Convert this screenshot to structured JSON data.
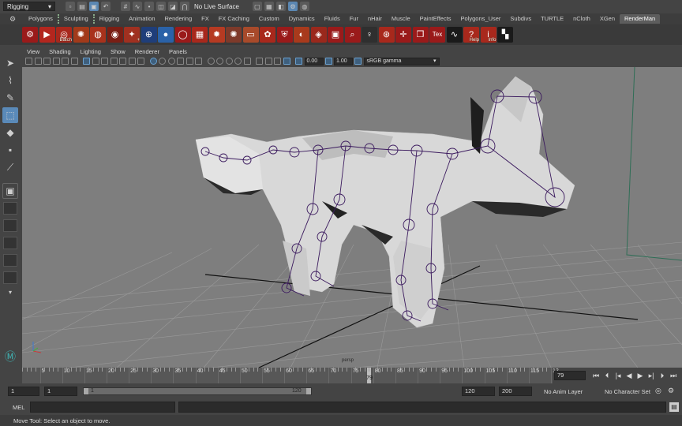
{
  "status_line": {
    "menu_set": "Rigging",
    "live_surface": "No Live Surface"
  },
  "shelf_tabs": [
    {
      "label": "Polygons",
      "sep": false,
      "active": false
    },
    {
      "label": "Sculpting",
      "sep": true,
      "active": false
    },
    {
      "label": "Rigging",
      "sep": true,
      "active": false
    },
    {
      "label": "Animation",
      "sep": false,
      "active": false
    },
    {
      "label": "Rendering",
      "sep": false,
      "active": false
    },
    {
      "label": "FX",
      "sep": false,
      "active": false
    },
    {
      "label": "FX Caching",
      "sep": false,
      "active": false
    },
    {
      "label": "Custom",
      "sep": false,
      "active": false
    },
    {
      "label": "Dynamics",
      "sep": false,
      "active": false
    },
    {
      "label": "Fluids",
      "sep": false,
      "active": false
    },
    {
      "label": "Fur",
      "sep": false,
      "active": false
    },
    {
      "label": "nHair",
      "sep": false,
      "active": false
    },
    {
      "label": "Muscle",
      "sep": false,
      "active": false
    },
    {
      "label": "PaintEffects",
      "sep": false,
      "active": false
    },
    {
      "label": "Polygons_User",
      "sep": false,
      "active": false
    },
    {
      "label": "Subdivs",
      "sep": false,
      "active": false
    },
    {
      "label": "TURTLE",
      "sep": false,
      "active": false
    },
    {
      "label": "nCloth",
      "sep": false,
      "active": false
    },
    {
      "label": "XGen",
      "sep": false,
      "active": false
    },
    {
      "label": "RenderMan",
      "sep": false,
      "active": true
    }
  ],
  "shelf_buttons": [
    {
      "name": "render-globals-icon",
      "color": "#9a1a1a",
      "glyph": "⚙",
      "label": ""
    },
    {
      "name": "render-icon",
      "color": "#b3261e",
      "glyph": "▶",
      "label": ""
    },
    {
      "name": "batch-render-icon",
      "color": "#a8281c",
      "glyph": "◎",
      "label": "Batch"
    },
    {
      "name": "interactive-render-icon",
      "color": "#a23a1a",
      "glyph": "✺",
      "label": ""
    },
    {
      "name": "ribbox-icon",
      "color": "#a8321c",
      "glyph": "◍",
      "label": ""
    },
    {
      "name": "eye-icon",
      "color": "#7a1e14",
      "glyph": "◉",
      "label": ""
    },
    {
      "name": "light-icon",
      "color": "#a03020",
      "glyph": "✦",
      "label": "+"
    },
    {
      "name": "sphere-wire-icon",
      "color": "#1f3e7a",
      "glyph": "⊕",
      "label": ""
    },
    {
      "name": "sphere-icon",
      "color": "#2a62a8",
      "glyph": "●",
      "label": ""
    },
    {
      "name": "ring-icon",
      "color": "#9a1a1a",
      "glyph": "◯",
      "label": ""
    },
    {
      "name": "texture-icon",
      "color": "#a8281c",
      "glyph": "▦",
      "label": ""
    },
    {
      "name": "dome-light-icon",
      "color": "#b63a22",
      "glyph": "✹",
      "label": ""
    },
    {
      "name": "env-light-icon",
      "color": "#7e3a2a",
      "glyph": "✺",
      "label": ""
    },
    {
      "name": "area-light-icon",
      "color": "#a84a2a",
      "glyph": "▭",
      "label": ""
    },
    {
      "name": "blobby-icon",
      "color": "#a8281c",
      "glyph": "✿",
      "label": ""
    },
    {
      "name": "material-icon",
      "color": "#9a1a1a",
      "glyph": "⛨",
      "label": ""
    },
    {
      "name": "surface-shader-icon",
      "color": "#a83a1c",
      "glyph": "◐",
      "label": ""
    },
    {
      "name": "displacement-icon",
      "color": "#9a281c",
      "glyph": "◈",
      "label": ""
    },
    {
      "name": "render-pass-icon",
      "color": "#9a1a1a",
      "glyph": "▣",
      "label": ""
    },
    {
      "name": "search-icon",
      "color": "#9a1a1a",
      "glyph": "⌕",
      "label": ""
    },
    {
      "name": "key-light-icon",
      "color": "#2f2f2f",
      "glyph": "♀",
      "label": ""
    },
    {
      "name": "target-icon",
      "color": "#a8281c",
      "glyph": "⊛",
      "label": ""
    },
    {
      "name": "crosshair-icon",
      "color": "#9a1a1a",
      "glyph": "✛",
      "label": ""
    },
    {
      "name": "cube-icon",
      "color": "#9a1a1a",
      "glyph": "❒",
      "label": ""
    },
    {
      "name": "texture-bake-icon",
      "color": "#9a1a1a",
      "glyph": "",
      "label": "Tex"
    },
    {
      "name": "shader-graph-icon",
      "color": "#1a1a1a",
      "glyph": "∿",
      "label": ""
    },
    {
      "name": "help-icon",
      "color": "#a8281c",
      "glyph": "?",
      "label": "Help"
    },
    {
      "name": "info-icon",
      "color": "#a8281c",
      "glyph": "i",
      "label": "Info"
    },
    {
      "name": "checker-icon",
      "color": "#1a1a1a",
      "glyph": "▚",
      "label": ""
    }
  ],
  "panel_menu": [
    "View",
    "Shading",
    "Lighting",
    "Show",
    "Renderer",
    "Panels"
  ],
  "panel_toolbar": {
    "value_a": "0.00",
    "value_b": "1.00",
    "color_space": "sRGB gamma"
  },
  "viewport": {
    "camera_label": "persp"
  },
  "time_slider": {
    "tick_labels": [
      "5",
      "10",
      "15",
      "20",
      "25",
      "30",
      "35",
      "40",
      "45",
      "50",
      "55",
      "60",
      "65",
      "70",
      "75",
      "80",
      "85",
      "90",
      "95",
      "100",
      "105",
      "110",
      "115",
      "12"
    ],
    "playhead": "79",
    "current_frame": "79"
  },
  "range_slider": {
    "start_time": "1",
    "playback_start": "1",
    "range_start": "1",
    "range_end": "120",
    "playback_end": "120",
    "end_time": "200",
    "anim_layer": "No Anim Layer",
    "character_set": "No Character Set"
  },
  "command_line": {
    "label": "MEL"
  },
  "help_line": {
    "text": "Move Tool: Select an object to move."
  }
}
